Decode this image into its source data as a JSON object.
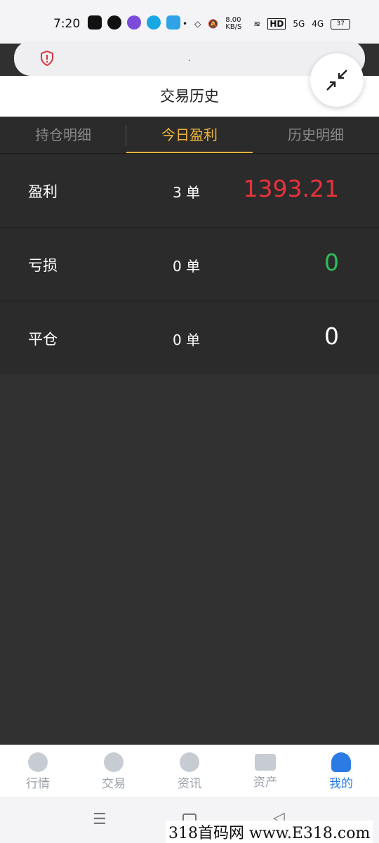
{
  "status": {
    "time": "7:20",
    "net_speed": "8.00 KB/S",
    "hd": "HD",
    "sig1": "5G",
    "sig2": "4G",
    "battery": "37"
  },
  "url": {
    "text": "."
  },
  "page": {
    "title": "交易历史"
  },
  "tabs": [
    {
      "label": "持仓明细"
    },
    {
      "label": "今日盈利",
      "active": true
    },
    {
      "label": "历史明细"
    }
  ],
  "rows": [
    {
      "label": "盈利",
      "count": "3 单",
      "value": "1393.21",
      "color": "#e8323c"
    },
    {
      "label": "亏损",
      "count": "0 单",
      "value": "0",
      "color": "#2fbd5b"
    },
    {
      "label": "平仓",
      "count": "0 单",
      "value": "0",
      "color": "#ffffff"
    }
  ],
  "bottom_nav": [
    {
      "label": "行情",
      "icon": "market-icon"
    },
    {
      "label": "交易",
      "icon": "trade-icon"
    },
    {
      "label": "资讯",
      "icon": "news-icon"
    },
    {
      "label": "资产",
      "icon": "wallet-icon"
    },
    {
      "label": "我的",
      "icon": "user-icon",
      "active": true
    }
  ],
  "watermark": "318首码网 www.E318.com"
}
